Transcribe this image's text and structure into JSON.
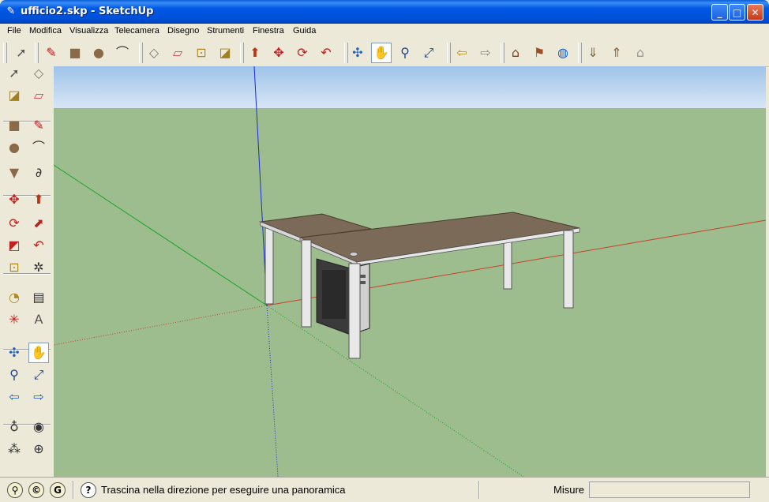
{
  "window": {
    "title": "ufficio2.skp - SketchUp",
    "controls": {
      "minimize": "_",
      "maximize": "□",
      "close": "✕"
    }
  },
  "menu": [
    {
      "label": "File",
      "key": "file"
    },
    {
      "label": "Modifica",
      "key": "modifica"
    },
    {
      "label": "Visualizza",
      "key": "visualizza"
    },
    {
      "label": "Telecamera",
      "key": "telecamera"
    },
    {
      "label": "Disegno",
      "key": "disegno"
    },
    {
      "label": "Strumenti",
      "key": "strumenti"
    },
    {
      "label": "Finestra",
      "key": "finestra"
    },
    {
      "label": "Guida",
      "key": "guida"
    }
  ],
  "toolbar_icons": [
    {
      "name": "select-icon",
      "glyph": "➚"
    },
    {
      "name": "pencil-icon",
      "glyph": "✎"
    },
    {
      "name": "rectangle-icon",
      "glyph": "■"
    },
    {
      "name": "circle-icon",
      "glyph": "●"
    },
    {
      "name": "arc-icon",
      "glyph": "⌒"
    },
    {
      "name": "make-component-icon",
      "glyph": "◇"
    },
    {
      "name": "eraser-icon",
      "glyph": "▱"
    },
    {
      "name": "tape-measure-icon",
      "glyph": "⊡"
    },
    {
      "name": "paint-bucket-icon",
      "glyph": "◪"
    },
    {
      "name": "push-pull-icon",
      "glyph": "⬆"
    },
    {
      "name": "move-icon",
      "glyph": "✥"
    },
    {
      "name": "rotate-icon",
      "glyph": "⟳"
    },
    {
      "name": "offset-icon",
      "glyph": "↶"
    },
    {
      "name": "orbit-icon",
      "glyph": "✣"
    },
    {
      "name": "pan-icon",
      "glyph": "✋"
    },
    {
      "name": "zoom-icon",
      "glyph": "⚲"
    },
    {
      "name": "zoom-extents-icon",
      "glyph": "⤢"
    },
    {
      "name": "previous-view-icon",
      "glyph": "⇦"
    },
    {
      "name": "next-view-icon",
      "glyph": "⇨"
    },
    {
      "name": "3d-warehouse-icon",
      "glyph": "⌂"
    },
    {
      "name": "add-location-icon",
      "glyph": "⚑"
    },
    {
      "name": "google-earth-icon",
      "glyph": "◍"
    },
    {
      "name": "get-models-icon",
      "glyph": "⇓"
    },
    {
      "name": "share-model-icon",
      "glyph": "⇑"
    },
    {
      "name": "send-to-layout-icon",
      "glyph": "⌂"
    }
  ],
  "side_toolbar_icons": [
    {
      "name": "select-icon",
      "glyph": "➚"
    },
    {
      "name": "make-component-icon",
      "glyph": "◇"
    },
    {
      "name": "paint-bucket-icon",
      "glyph": "◪"
    },
    {
      "name": "eraser-icon",
      "glyph": "▱"
    },
    {
      "name": "rectangle-icon",
      "glyph": "■"
    },
    {
      "name": "line-icon",
      "glyph": "✎"
    },
    {
      "name": "circle-icon",
      "glyph": "●"
    },
    {
      "name": "arc-icon",
      "glyph": "⌒"
    },
    {
      "name": "polygon-icon",
      "glyph": "▼"
    },
    {
      "name": "freehand-icon",
      "glyph": "∂"
    },
    {
      "name": "move-icon",
      "glyph": "✥"
    },
    {
      "name": "push-pull-icon",
      "glyph": "⬆"
    },
    {
      "name": "rotate-icon",
      "glyph": "⟳"
    },
    {
      "name": "follow-me-icon",
      "glyph": "⬈"
    },
    {
      "name": "scale-icon",
      "glyph": "◩"
    },
    {
      "name": "offset-icon",
      "glyph": "↶"
    },
    {
      "name": "tape-measure-icon",
      "glyph": "⊡"
    },
    {
      "name": "dimension-icon",
      "glyph": "✲"
    },
    {
      "name": "protractor-icon",
      "glyph": "◔"
    },
    {
      "name": "text-icon",
      "glyph": "▤"
    },
    {
      "name": "axes-icon",
      "glyph": "✳"
    },
    {
      "name": "3d-text-icon",
      "glyph": "A"
    },
    {
      "name": "orbit-icon",
      "glyph": "✣"
    },
    {
      "name": "pan-icon",
      "glyph": "✋"
    },
    {
      "name": "zoom-icon",
      "glyph": "⚲"
    },
    {
      "name": "zoom-window-icon",
      "glyph": "⤢"
    },
    {
      "name": "previous-view-icon",
      "glyph": "⇦"
    },
    {
      "name": "next-view-icon",
      "glyph": "⇨"
    },
    {
      "name": "position-camera-icon",
      "glyph": "♁"
    },
    {
      "name": "look-around-icon",
      "glyph": "◉"
    },
    {
      "name": "walk-icon",
      "glyph": "⁂"
    },
    {
      "name": "section-plane-icon",
      "glyph": "⊕"
    }
  ],
  "status": {
    "message": "Trascina nella direzione per eseguire una panoramica",
    "measure_label": "Misure",
    "measure_value": "",
    "icons": [
      {
        "name": "geo-location-icon",
        "glyph": "⚲"
      },
      {
        "name": "credits-icon",
        "glyph": "©"
      },
      {
        "name": "google-account-icon",
        "glyph": "G"
      },
      {
        "name": "help-icon",
        "glyph": "?"
      }
    ]
  },
  "colors": {
    "sky_top": "#9fc3ea",
    "sky_bottom": "#d7e6f5",
    "ground": "#9dbd8f",
    "desktop": "#7b6a58",
    "red_axis": "#c8402a",
    "green_axis": "#1aa52a",
    "blue_axis": "#1c2bdb",
    "leg": "#e8e8e8",
    "cabinet": "#3a3a3a"
  }
}
